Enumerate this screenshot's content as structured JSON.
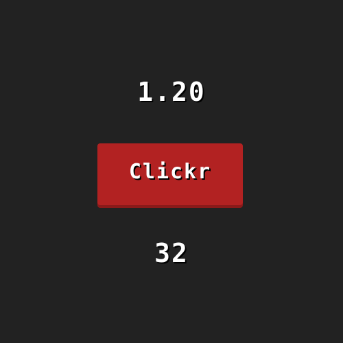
{
  "game": {
    "top_value": "1.20",
    "button_label": "Clickr",
    "bottom_value": "32"
  },
  "colors": {
    "background": "#222222",
    "button": "#b22222",
    "button_shadow": "#8a1a1a",
    "text": "#ffffff"
  }
}
